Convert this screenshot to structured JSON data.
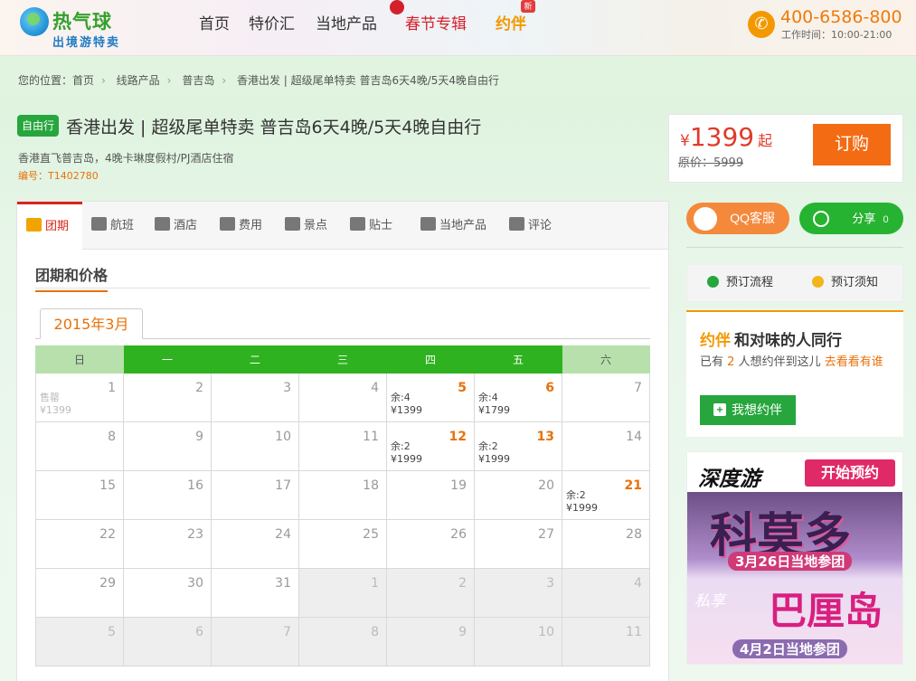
{
  "header": {
    "logo_name": "热气球",
    "logo_slogan": "出境游特卖",
    "nav": [
      {
        "label": "首页"
      },
      {
        "label": "特价汇"
      },
      {
        "label": "当地产品"
      },
      {
        "label": "春节专辑"
      },
      {
        "label": "约伴"
      }
    ],
    "new_tag": "新",
    "phone": "400-6586-800",
    "hours": "工作时间：10:00-21:00"
  },
  "breadcrumb": [
    "您的位置：首页",
    "线路产品",
    "普吉岛",
    "香港出发 | 超级尾单特卖 普吉岛6天4晚/5天4晚自由行"
  ],
  "product": {
    "badge": "自由行",
    "title": "香港出发 | 超级尾单特卖 普吉岛6天4晚/5天4晚自由行",
    "subtitle": "香港直飞普吉岛，4晚卡琳度假村/PJ酒店住宿",
    "code": "编号：T1402780",
    "price_currency": "¥",
    "price": "1399",
    "price_suffix": "起",
    "original_price": "原价：5999",
    "order_label": "订购"
  },
  "tabs": [
    {
      "label": "团期",
      "icon": "calendar-icon"
    },
    {
      "label": "航班",
      "icon": "plane-icon"
    },
    {
      "label": "酒店",
      "icon": "bed-icon"
    },
    {
      "label": "费用",
      "icon": "wallet-icon"
    },
    {
      "label": "景点",
      "icon": "location-pin-icon"
    },
    {
      "label": "贴士",
      "icon": "tips-icon"
    },
    {
      "label": "当地产品",
      "icon": "map-icon"
    },
    {
      "label": "评论",
      "icon": "comment-icon"
    }
  ],
  "section_title": "团期和价格",
  "calendar": {
    "month_label": "2015年3月",
    "weekdays": [
      "日",
      "一",
      "二",
      "三",
      "四",
      "五",
      "六"
    ],
    "weeks": [
      [
        {
          "d": "1",
          "st": "售罄",
          "pr": "¥1399",
          "sold": true
        },
        {
          "d": "2"
        },
        {
          "d": "3"
        },
        {
          "d": "4"
        },
        {
          "d": "5",
          "st": "余:4",
          "pr": "¥1399",
          "avail": true
        },
        {
          "d": "6",
          "st": "余:4",
          "pr": "¥1799",
          "avail": true
        },
        {
          "d": "7"
        }
      ],
      [
        {
          "d": "8"
        },
        {
          "d": "9"
        },
        {
          "d": "10"
        },
        {
          "d": "11"
        },
        {
          "d": "12",
          "st": "余:2",
          "pr": "¥1999",
          "avail": true
        },
        {
          "d": "13",
          "st": "余:2",
          "pr": "¥1999",
          "avail": true
        },
        {
          "d": "14"
        }
      ],
      [
        {
          "d": "15"
        },
        {
          "d": "16"
        },
        {
          "d": "17"
        },
        {
          "d": "18"
        },
        {
          "d": "19"
        },
        {
          "d": "20"
        },
        {
          "d": "21",
          "st": "余:2",
          "pr": "¥1999",
          "avail": true
        }
      ],
      [
        {
          "d": "22"
        },
        {
          "d": "23"
        },
        {
          "d": "24"
        },
        {
          "d": "25"
        },
        {
          "d": "26"
        },
        {
          "d": "27"
        },
        {
          "d": "28"
        }
      ],
      [
        {
          "d": "29"
        },
        {
          "d": "30"
        },
        {
          "d": "31"
        },
        {
          "d": "1",
          "out": true
        },
        {
          "d": "2",
          "out": true
        },
        {
          "d": "3",
          "out": true
        },
        {
          "d": "4",
          "out": true
        }
      ],
      [
        {
          "d": "5",
          "out": true
        },
        {
          "d": "6",
          "out": true
        },
        {
          "d": "7",
          "out": true
        },
        {
          "d": "8",
          "out": true
        },
        {
          "d": "9",
          "out": true
        },
        {
          "d": "10",
          "out": true
        },
        {
          "d": "11",
          "out": true
        }
      ]
    ]
  },
  "side": {
    "qq_label": "QQ客服",
    "share_label": "分享",
    "share_count": "0",
    "process_label": "预订流程",
    "notice_label": "预订须知",
    "yueban_brand": "约伴",
    "yueban_title": "和对味的人同行",
    "yueban_text_pre": "已有",
    "yueban_count": "2",
    "yueban_text_mid": "人想约伴到这儿",
    "yueban_link": "去看看有谁",
    "yueban_button": "我想约伴"
  },
  "banner": {
    "brand": "深度游",
    "cta": "开始预约",
    "dest1": "科莫多",
    "date1": "3月26日当地参团",
    "tag2": "私享",
    "dest2": "巴厘岛",
    "date2": "4月2日当地参团"
  },
  "colors": {
    "accent": "#f36b13",
    "green": "#2fb21f",
    "red": "#d9261c",
    "orange": "#e8710a"
  }
}
